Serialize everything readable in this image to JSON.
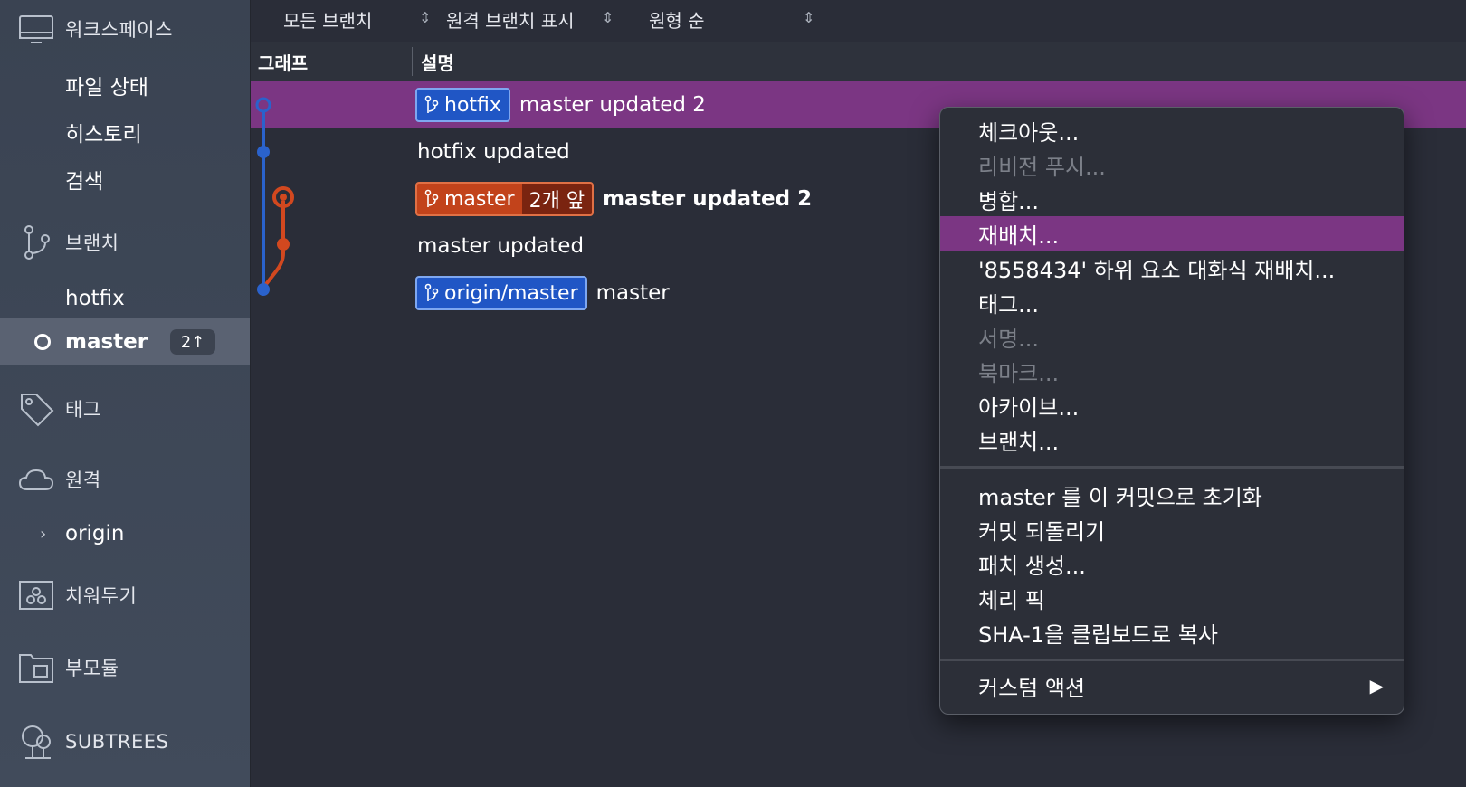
{
  "sidebar": {
    "workspace_label": "워크스페이스",
    "workspace_items": [
      "파일 상태",
      "히스토리",
      "검색"
    ],
    "branches_label": "브랜치",
    "branches": [
      {
        "name": "hotfix"
      },
      {
        "name": "master",
        "ahead": "2↑"
      }
    ],
    "tags_label": "태그",
    "remotes_label": "원격",
    "remotes": [
      "origin"
    ],
    "stashes_label": "치워두기",
    "submodules_label": "부모듈",
    "subtrees_label": "SUBTREES"
  },
  "toolbar": {
    "branch_filter": "모든 브랜치",
    "remote_filter": "원격 브랜치 표시",
    "sort_order": "원형 순"
  },
  "columns": {
    "graph": "그래프",
    "description": "설명"
  },
  "commits": [
    {
      "labels": [
        {
          "text": "hotfix",
          "type": "local"
        }
      ],
      "message": "master updated 2",
      "selected": true
    },
    {
      "labels": [],
      "message": "hotfix updated"
    },
    {
      "labels": [
        {
          "text": "master",
          "type": "head",
          "ahead": "2개 앞"
        }
      ],
      "message": "master updated 2",
      "bold": true
    },
    {
      "labels": [],
      "message": "master updated"
    },
    {
      "labels": [
        {
          "text": "origin/master",
          "type": "remote"
        }
      ],
      "message": "master"
    }
  ],
  "context_menu": {
    "items": [
      {
        "label": "체크아웃...",
        "enabled": true
      },
      {
        "label": "리비전 푸시...",
        "enabled": false
      },
      {
        "label": "병합...",
        "enabled": true
      },
      {
        "label": "재배치...",
        "enabled": true,
        "highlighted": true
      },
      {
        "label": "'8558434' 하위 요소 대화식 재배치...",
        "enabled": true
      },
      {
        "label": "태그...",
        "enabled": true
      },
      {
        "label": "서명...",
        "enabled": false
      },
      {
        "label": "북마크...",
        "enabled": false
      },
      {
        "label": "아카이브...",
        "enabled": true
      },
      {
        "label": "브랜치...",
        "enabled": true
      },
      {
        "label": "master 를 이 커밋으로 초기화",
        "enabled": true
      },
      {
        "label": "커밋 되돌리기",
        "enabled": true
      },
      {
        "label": "패치 생성...",
        "enabled": true
      },
      {
        "label": "체리 픽",
        "enabled": true
      },
      {
        "label": "SHA-1을 클립보드로 복사",
        "enabled": true
      },
      {
        "label": "커스텀 액션",
        "enabled": true,
        "submenu": true
      }
    ],
    "submenu_arrow": "▶"
  },
  "colors": {
    "selection": "#7b3683",
    "sidebar": "#3e4757",
    "local_branch": "#2056c5",
    "head_branch": "#c2431b",
    "graph_blue": "#2a62cc",
    "graph_orange": "#d2481f"
  }
}
